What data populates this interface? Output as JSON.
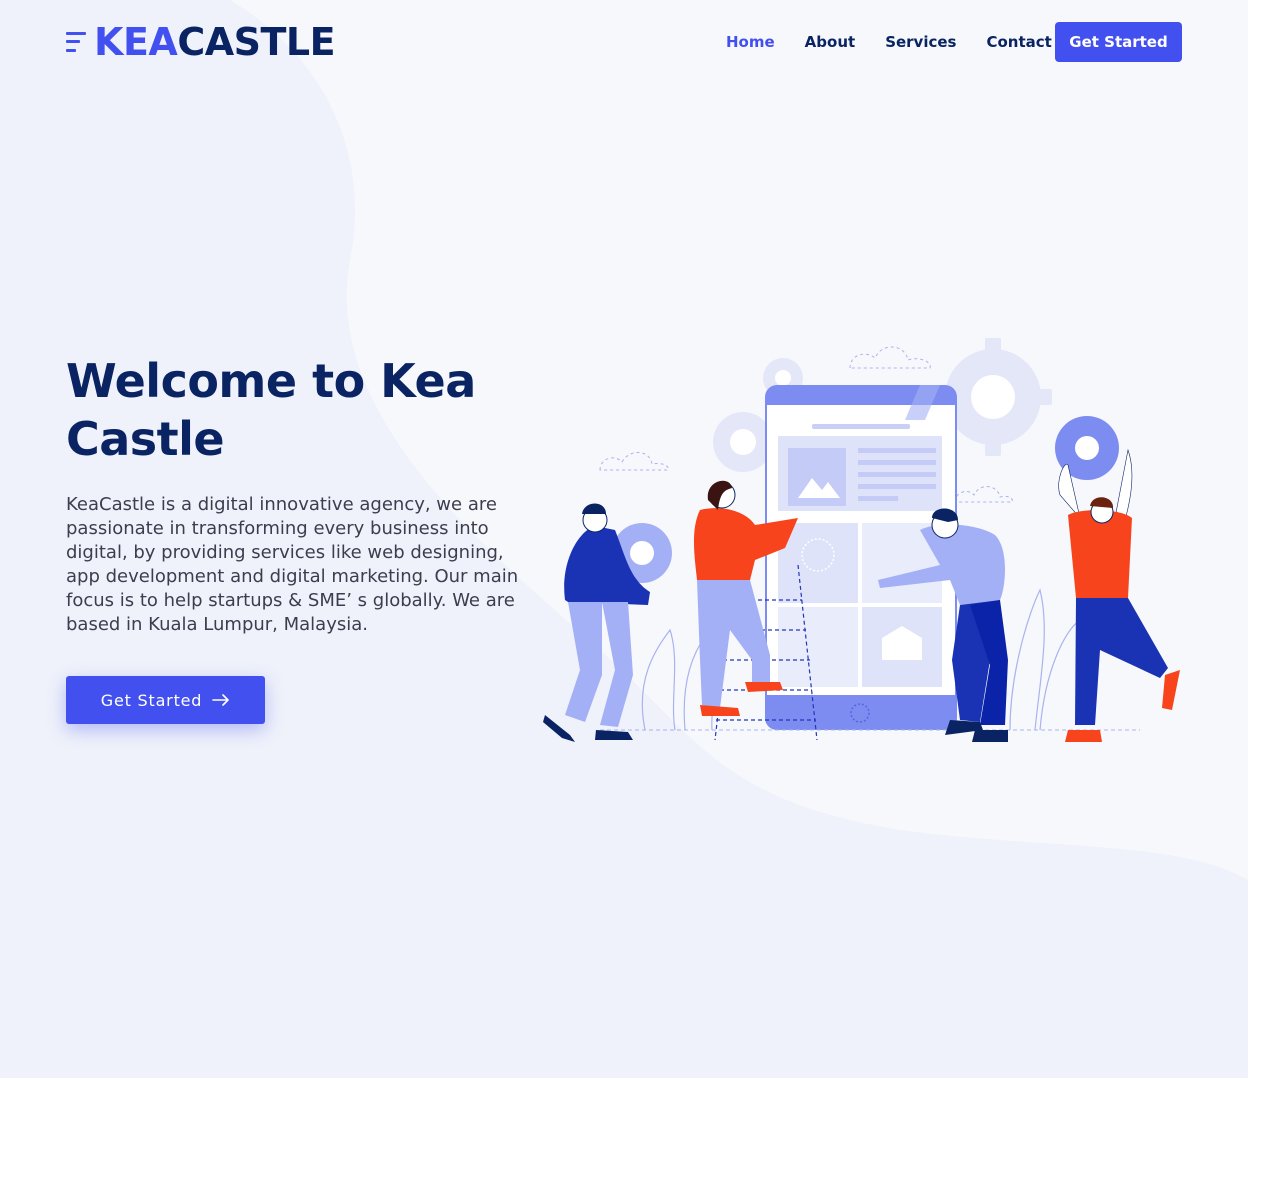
{
  "brand": {
    "name_part1": "KEA",
    "name_part2": "CASTLE"
  },
  "nav": {
    "items": [
      {
        "label": "Home",
        "active": true
      },
      {
        "label": "About",
        "active": false
      },
      {
        "label": "Services",
        "active": false
      },
      {
        "label": "Contact",
        "active": false
      }
    ],
    "cta_label": "Get Started"
  },
  "hero": {
    "title": "Welcome to Kea Castle",
    "description": "KeaCastle is a digital innovative agency, we are passionate in transforming every business into digital, by providing services like web designing, app development and digital marketing. Our main focus is to help startups & SME’ s globally. We are based in Kuala Lumpur, Malaysia.",
    "button_label": "Get Started",
    "button_icon": "arrow-right-icon"
  },
  "colors": {
    "primary": "#4350f0",
    "navy": "#0a2463",
    "hero_bg": "#eff2fa",
    "accent_orange": "#f7441d"
  }
}
